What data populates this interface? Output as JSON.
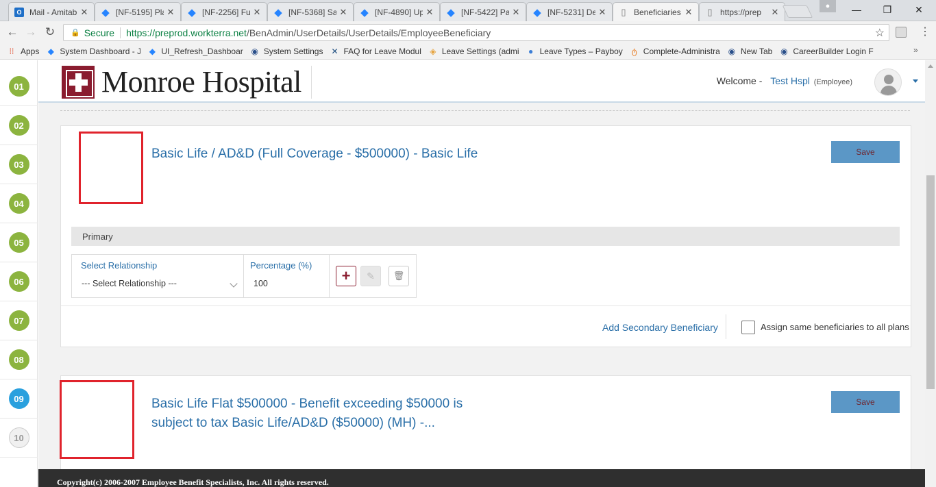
{
  "browser": {
    "tabs": [
      {
        "title": "Mail - Amitab",
        "icon": "outlook-icon",
        "active": false
      },
      {
        "title": "[NF-5195] Pla",
        "icon": "jira-icon",
        "active": false
      },
      {
        "title": "[NF-2256] Fu",
        "icon": "jira-icon",
        "active": false
      },
      {
        "title": "[NF-5368] Sa",
        "icon": "jira-icon",
        "active": false
      },
      {
        "title": "[NF-4890] Up",
        "icon": "jira-icon",
        "active": false
      },
      {
        "title": "[NF-5422] Pa",
        "icon": "jira-icon",
        "active": false
      },
      {
        "title": "[NF-5231] De",
        "icon": "jira-icon",
        "active": false
      },
      {
        "title": "Beneficiaries",
        "icon": "page-icon",
        "active": true
      },
      {
        "title": "https://prep",
        "icon": "page-icon",
        "active": false
      }
    ],
    "secure_label": "Secure",
    "url_host": "https://preprod.workterra.net",
    "url_path": "/BenAdmin/UserDetails/UserDetails/EmployeeBeneficiary",
    "bookmarks": [
      {
        "label": "Apps",
        "icon": "apps-grid-icon"
      },
      {
        "label": "System Dashboard - J",
        "icon": "jira-icon"
      },
      {
        "label": "UI_Refresh_Dashboar",
        "icon": "jira-icon"
      },
      {
        "label": "System Settings",
        "icon": "site-icon"
      },
      {
        "label": "FAQ for Leave Modul",
        "icon": "confluence-icon"
      },
      {
        "label": "Leave Settings (admi",
        "icon": "site-icon"
      },
      {
        "label": "Leave Types – Payboy",
        "icon": "site-icon"
      },
      {
        "label": "Complete-Administra",
        "icon": "site-icon"
      },
      {
        "label": "New Tab",
        "icon": "site-icon"
      },
      {
        "label": "CareerBuilder Login F",
        "icon": "site-icon"
      }
    ],
    "bookmarks_more": "»"
  },
  "stepper": {
    "steps": [
      {
        "label": "01",
        "state": "done"
      },
      {
        "label": "02",
        "state": "done"
      },
      {
        "label": "03",
        "state": "done"
      },
      {
        "label": "04",
        "state": "done"
      },
      {
        "label": "05",
        "state": "done"
      },
      {
        "label": "06",
        "state": "done"
      },
      {
        "label": "07",
        "state": "done"
      },
      {
        "label": "08",
        "state": "done"
      },
      {
        "label": "09",
        "state": "current"
      },
      {
        "label": "10",
        "state": "pending"
      }
    ]
  },
  "header": {
    "logo_text": "Monroe Hospital",
    "welcome_label": "Welcome -",
    "user_name": "Test Hspl",
    "user_role": "(Employee)"
  },
  "plans": [
    {
      "title": "Basic Life / AD&D (Full Coverage - $500000) - Basic Life",
      "save_label": "Save",
      "primary_label": "Primary",
      "relationship_label": "Select Relationship",
      "relationship_value": "--- Select Relationship ---",
      "percentage_label": "Percentage (%)",
      "percentage_value": "100",
      "add_secondary_label": "Add Secondary Beneficiary",
      "assign_same_label": "Assign same beneficiaries to all plans"
    },
    {
      "title": "Basic Life Flat $500000 - Benefit exceeding $50000 is subject to tax Basic Life/AD&D ($50000) (MH) -...",
      "save_label": "Save"
    }
  ],
  "footer": {
    "copyright": "Copyright(c) 2006-2007 Employee Benefit Specialists, Inc. All rights reserved."
  },
  "colors": {
    "accent": "#2a6fa8",
    "step_done": "#8cb43f",
    "step_current": "#2aa0de",
    "brand": "#8a1c2f",
    "save_button": "#5b97c6",
    "highlight_box": "#e0232c"
  }
}
